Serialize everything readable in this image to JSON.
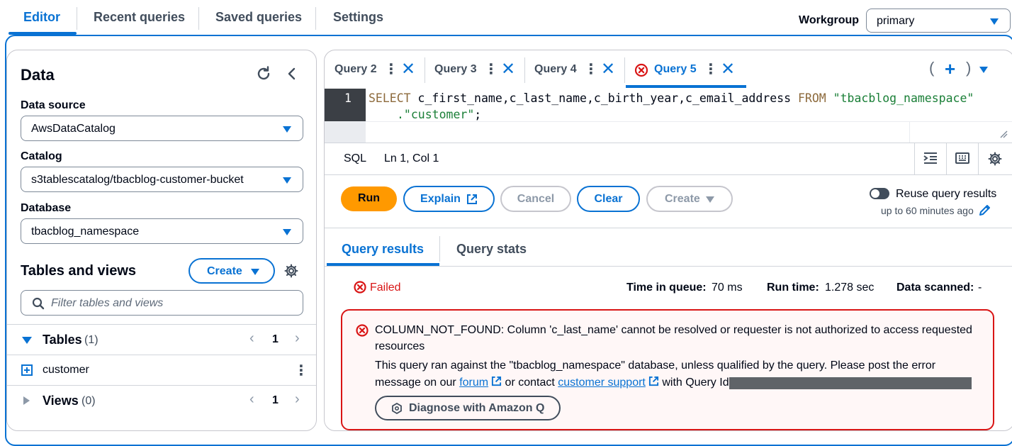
{
  "top_tabs": [
    "Editor",
    "Recent queries",
    "Saved queries",
    "Settings"
  ],
  "workgroup": {
    "label": "Workgroup",
    "value": "primary"
  },
  "data_panel": {
    "title": "Data",
    "data_source": {
      "label": "Data source",
      "value": "AwsDataCatalog"
    },
    "catalog": {
      "label": "Catalog",
      "value": "s3tablescatalog/tbacblog-customer-bucket"
    },
    "database": {
      "label": "Database",
      "value": "tbacblog_namespace"
    },
    "tables_views_title": "Tables and views",
    "create_label": "Create",
    "filter_placeholder": "Filter tables and views",
    "tables": {
      "label": "Tables",
      "count": "(1)",
      "page": "1",
      "items": [
        "customer"
      ]
    },
    "views": {
      "label": "Views",
      "count": "(0)",
      "page": "1"
    }
  },
  "query_tabs": [
    {
      "label": "Query 2",
      "error": false
    },
    {
      "label": "Query 3",
      "error": false
    },
    {
      "label": "Query 4",
      "error": false
    },
    {
      "label": "Query 5",
      "error": true,
      "active": true
    }
  ],
  "editor": {
    "line_number": "1",
    "sql_parts": [
      "SELECT",
      " c_first_name,c_last_name,c_birth_year,c_email_address ",
      "FROM",
      " ",
      "\"tbacblog_namespace\""
    ],
    "sql_line2": ".\"customer\"",
    "sql_line2_end": ";",
    "language": "SQL",
    "position": "Ln 1, Col 1"
  },
  "actions": {
    "run": "Run",
    "explain": "Explain",
    "cancel": "Cancel",
    "clear": "Clear",
    "create": "Create",
    "reuse_label": "Reuse query results",
    "reuse_sub": "up to 60 minutes ago"
  },
  "results_tabs": [
    "Query results",
    "Query stats"
  ],
  "status": {
    "state": "Failed",
    "time_in_queue_label": "Time in queue:",
    "time_in_queue": "70 ms",
    "run_time_label": "Run time:",
    "run_time": "1.278 sec",
    "data_scanned_label": "Data scanned:",
    "data_scanned": "-"
  },
  "error": {
    "line1": "COLUMN_NOT_FOUND: Column 'c_last_name' cannot be resolved or requester is not authorized to access requested",
    "line2": "resources",
    "line3": "This query ran against the \"tbacblog_namespace\" database, unless qualified by the query. Please post the error",
    "line4_pre": "message on our",
    "forum": "forum",
    "line4_mid": "or contact",
    "support": "customer support",
    "line4_post": "with Query Id:",
    "diagnose": "Diagnose with Amazon Q"
  },
  "colors": {
    "accent": "#0972d3",
    "run": "#ff9900",
    "error": "#d91515"
  }
}
